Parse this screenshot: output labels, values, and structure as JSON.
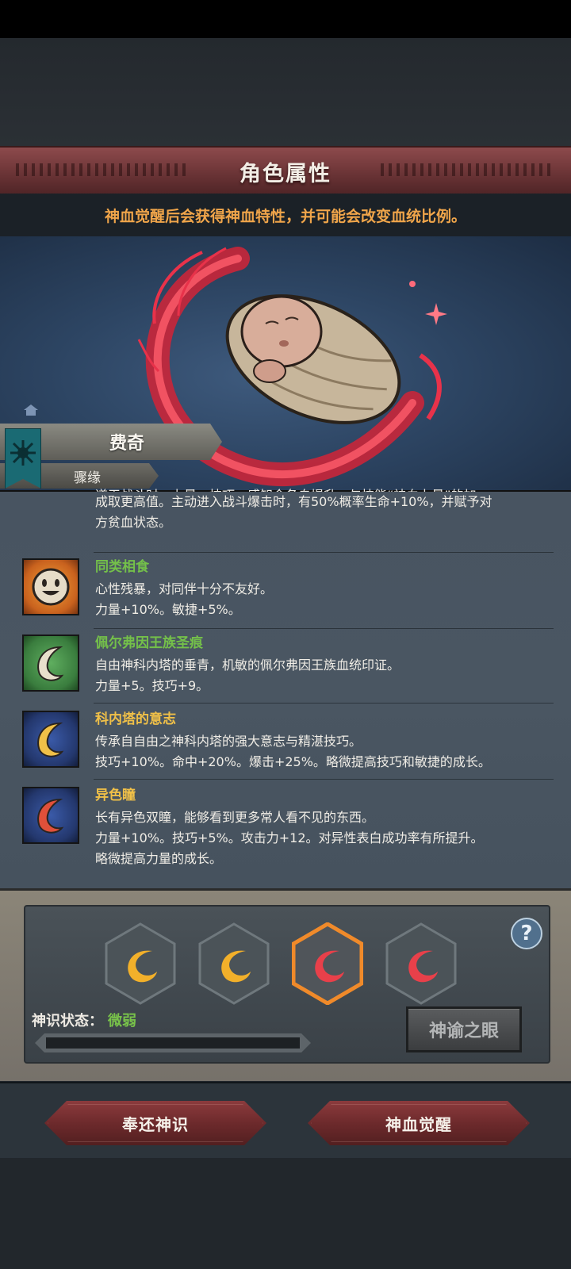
{
  "title": "角色属性",
  "hint": "神血觉醒后会获得神血特性，并可能会改变血统比例。",
  "character": {
    "name": "费奇",
    "lineage": "骤缘"
  },
  "partial_trait": {
    "line1": "道天战斗时，力量、技巧、感知会各自提升，与技能“神血力量”的加",
    "line2": "成取更高值。主动进入战斗爆击时，有50%概率生命+10%，并赋予对",
    "line3": "方贫血状态。"
  },
  "traits": [
    {
      "name": "同类相食",
      "name_color": "#74c04a",
      "icon": "smiley-face-icon",
      "lines": [
        "心性残暴，对同伴十分不友好。",
        "力量+10%。敏捷+5%。"
      ]
    },
    {
      "name": "佩尔弗因王族圣痕",
      "name_color": "#74c04a",
      "icon": "white-crescent-icon",
      "lines": [
        "自由神科内塔的垂青，机敏的佩尔弗因王族血统印证。",
        "力量+5。技巧+9。"
      ]
    },
    {
      "name": "科内塔的意志",
      "name_color": "#f0c048",
      "icon": "gold-crescent-icon",
      "lines": [
        "传承自自由之神科内塔的强大意志与精湛技巧。",
        "技巧+10%。命中+20%。爆击+25%。略微提高技巧和敏捷的成长。"
      ]
    },
    {
      "name": "异色瞳",
      "name_color": "#f0c048",
      "icon": "red-crescent-icon",
      "lines": [
        "长有异色双瞳，能够看到更多常人看不见的东西。",
        "力量+10%。技巧+5%。攻击力+12。对异性表白成功率有所提升。",
        "略微提高力量的成长。"
      ]
    }
  ],
  "god_slots": [
    {
      "icon": "gold-crescent-slot-icon",
      "selected": false
    },
    {
      "icon": "gold-crescent-slot-icon",
      "selected": false
    },
    {
      "icon": "red-crescent-slot-icon",
      "selected": true
    },
    {
      "icon": "red-crescent-slot-icon",
      "selected": false
    }
  ],
  "status": {
    "label": "神识状态：",
    "value": "微弱",
    "level": 0.0
  },
  "help_label": "?",
  "oracle_button": "神谕之眼",
  "buttons": {
    "return": "奉还神识",
    "awaken": "神血觉醒"
  },
  "colors": {
    "accent_orange": "#f0a54a",
    "green": "#74c04a",
    "gold": "#f0c048",
    "red": "#e0403a"
  }
}
